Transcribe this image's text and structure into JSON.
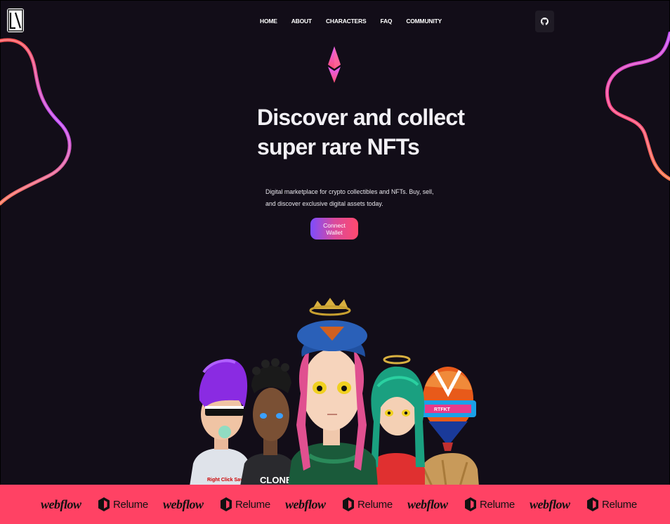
{
  "nav": {
    "items": [
      {
        "label": "HOME"
      },
      {
        "label": "ABOUT"
      },
      {
        "label": "CHARACTERS"
      },
      {
        "label": "FAQ"
      },
      {
        "label": "COMMUNITY"
      }
    ]
  },
  "hero": {
    "title_line1": "Discover and collect",
    "title_line2": "super rare NFTs",
    "subtitle": "Digital marketplace for crypto collectibles and NFTs. Buy, sell, and discover exclusive digital assets today.",
    "cta_label": "Connect Wallet"
  },
  "characters": {
    "shirt_text_1": "Right Click Save",
    "shirt_text_2": "CLONE",
    "visor_text": "RTFKT"
  },
  "partners": {
    "webflow": "webflow",
    "relume": "Relume"
  },
  "colors": {
    "background": "#120d18",
    "band": "#ff4264",
    "accent_purple": "#7c4dff",
    "accent_pink": "#ff4a6e"
  }
}
